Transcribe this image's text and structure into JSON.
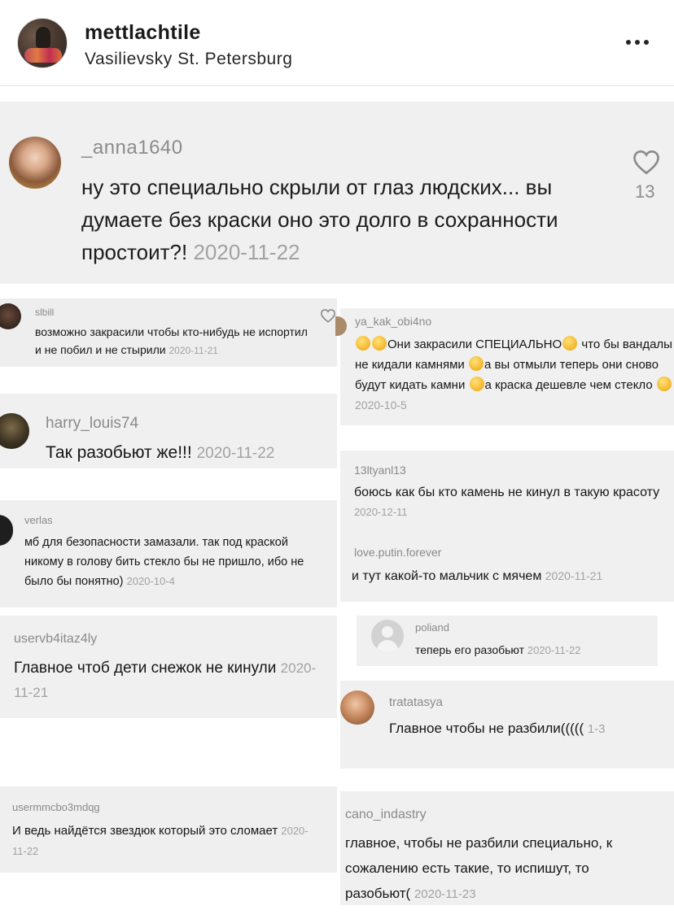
{
  "post": {
    "username": "mettlachtile",
    "location": "Vasilievsky St. Petersburg",
    "more_icon": "more-horizontal-icon"
  },
  "comments": {
    "anna": {
      "username": "_anna1640",
      "text": "ну это специально скрыли от глаз людских... вы думаете без краски оно это долго в сохранности простоит?!",
      "date": "2020-11-22",
      "likes": "13"
    },
    "slbill": {
      "username": "slbill",
      "text": "возможно закрасили чтобы кто-нибудь не испортил и не побил и не стырили",
      "date": "2020-11-21"
    },
    "yakak": {
      "username": "ya_kak_obi4no",
      "text_1": "Они закрасили СПЕЦИАЛЬНО",
      "text_2": " что бы вандалы не кидали камнями ",
      "text_3": "а вы отмыли теперь они сново будут кидать камни ",
      "text_4": "а краска дешевле чем стекло ",
      "date": "2020-10-5"
    },
    "harry": {
      "username": "harry_louis74",
      "text": "Так разобьют же!!!",
      "date": "2020-11-22"
    },
    "ltyanl": {
      "username": "13ltyanl13",
      "text": "боюсь как бы кто камень не кинул в такую красоту",
      "date": "2020-12-11"
    },
    "putin": {
      "username": "love.putin.forever",
      "text": "и тут какой-то мальчик с мячем",
      "date": "2020-11-21"
    },
    "verlas": {
      "username": "verlas",
      "text": "мб для безопасности замазали. так под краской никому в голову бить стекло бы не пришло, ибо не было бы понятно)",
      "date": "2020-10-4"
    },
    "poliand": {
      "username": "poliand",
      "text": "теперь его разобьют",
      "date": "2020-11-22"
    },
    "uservb": {
      "username": "uservb4itaz4ly",
      "text": "Главное чтоб дети снежок не кинули",
      "date": "2020-11-21"
    },
    "trata": {
      "username": "tratatasya",
      "text": "Главное чтобы не разбили(((((",
      "date": "1-3"
    },
    "userm": {
      "username": "usermmcbo3mdqg",
      "text": "И ведь найдётся звездюк который это сломает",
      "date": "2020-11-22"
    },
    "cano": {
      "username": "cano_indastry",
      "line_1": "главное, чтобы не разбили специально, к",
      "line_2": "сожалению есть такие, то испишут, то",
      "line_3": "разобьют(",
      "date": "2020-11-23"
    }
  }
}
